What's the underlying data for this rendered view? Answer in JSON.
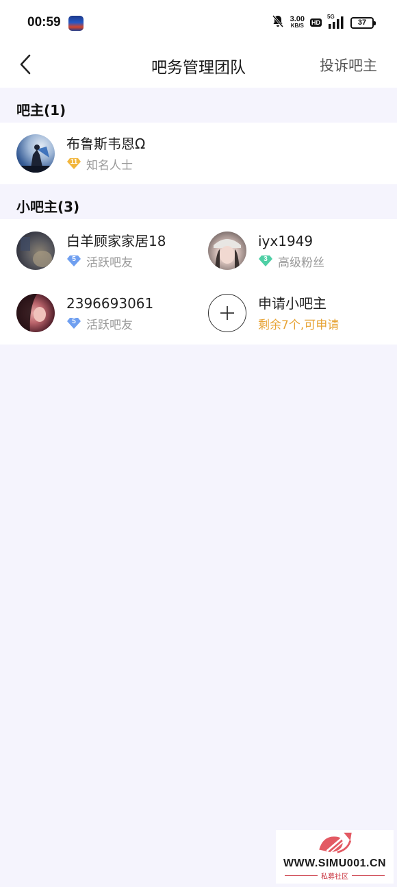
{
  "status_bar": {
    "time": "00:59",
    "net_speed_value": "3.00",
    "net_speed_unit": "KB/S",
    "hd": "HD",
    "network": "5G",
    "battery": "37"
  },
  "navbar": {
    "title": "吧务管理团队",
    "action": "投诉吧主"
  },
  "owner_section": {
    "title": "吧主(1)",
    "members": [
      {
        "name": "布鲁斯韦恩Ω",
        "level": "11",
        "level_title": "知名人士",
        "badge_color": "#f2b63c"
      }
    ]
  },
  "assistant_section": {
    "title": "小吧主(3)",
    "members": [
      {
        "name": "白羊顾家家居18",
        "level": "5",
        "level_title": "活跃吧友",
        "badge_color": "#6f9ff0"
      },
      {
        "name": "iyx1949",
        "level": "3",
        "level_title": "高级粉丝",
        "badge_color": "#4fcfa5"
      },
      {
        "name": "2396693061",
        "level": "5",
        "level_title": "活跃吧友",
        "badge_color": "#6f9ff0"
      }
    ],
    "apply": {
      "label": "申请小吧主",
      "sub": "剩余7个,可申请"
    }
  },
  "watermark": {
    "url": "WWW.SIMU001.CN",
    "sub": "私募社区"
  }
}
